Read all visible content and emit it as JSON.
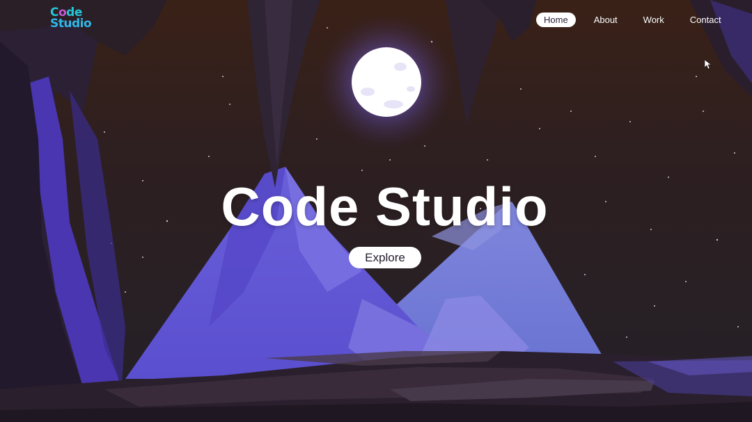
{
  "logo": {
    "line1_prefix": "C",
    "line1_accent": "o",
    "line1_suffix": "de",
    "line2": "Studio"
  },
  "nav": {
    "items": [
      {
        "label": "Home",
        "active": true
      },
      {
        "label": "About",
        "active": false
      },
      {
        "label": "Work",
        "active": false
      },
      {
        "label": "Contact",
        "active": false
      }
    ]
  },
  "hero": {
    "title": "Code Studio",
    "button_label": "Explore"
  },
  "colors": {
    "sky_top": "#2d1a16",
    "sky_bottom": "#2a2030",
    "mountain": "#6a63d6",
    "moon": "#ffffff",
    "logo_teal": "#25c7d9",
    "logo_purple": "#c45bd8"
  },
  "icons": {
    "cursor": "mouse-pointer-icon"
  }
}
